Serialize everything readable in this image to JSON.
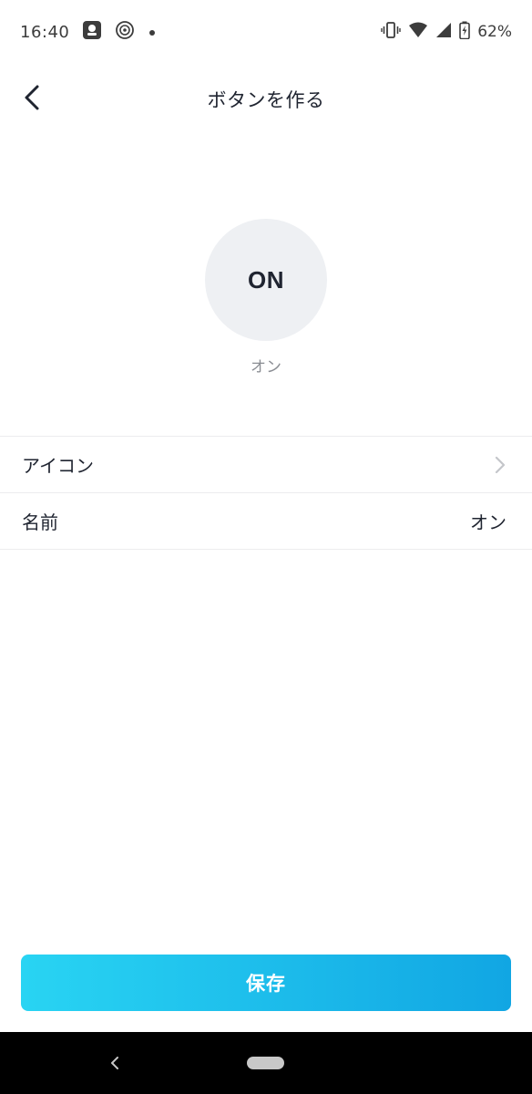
{
  "status_bar": {
    "time": "16:40",
    "battery_percent": "62%",
    "icons": [
      "assistant-icon",
      "podcast-icon",
      "notification-dot-icon",
      "vibrate-icon",
      "wifi-icon",
      "signal-icon",
      "battery-charging-icon"
    ]
  },
  "header": {
    "title": "ボタンを作る",
    "back_icon": "back-arrow-icon"
  },
  "preview": {
    "icon_text": "ON",
    "label": "オン"
  },
  "settings": {
    "icon_row": {
      "label": "アイコン",
      "chevron_icon": "chevron-right-icon"
    },
    "name_row": {
      "label": "名前",
      "value": "オン"
    }
  },
  "actions": {
    "save_label": "保存"
  },
  "nav_bar": {
    "back_icon": "nav-back-icon",
    "home_icon": "nav-home-pill"
  },
  "colors": {
    "accent_start": "#29d4f3",
    "accent_end": "#11a6e3",
    "preview_bg": "#eef0f3",
    "text_primary": "#1f2430",
    "text_secondary": "#8a8d93"
  }
}
